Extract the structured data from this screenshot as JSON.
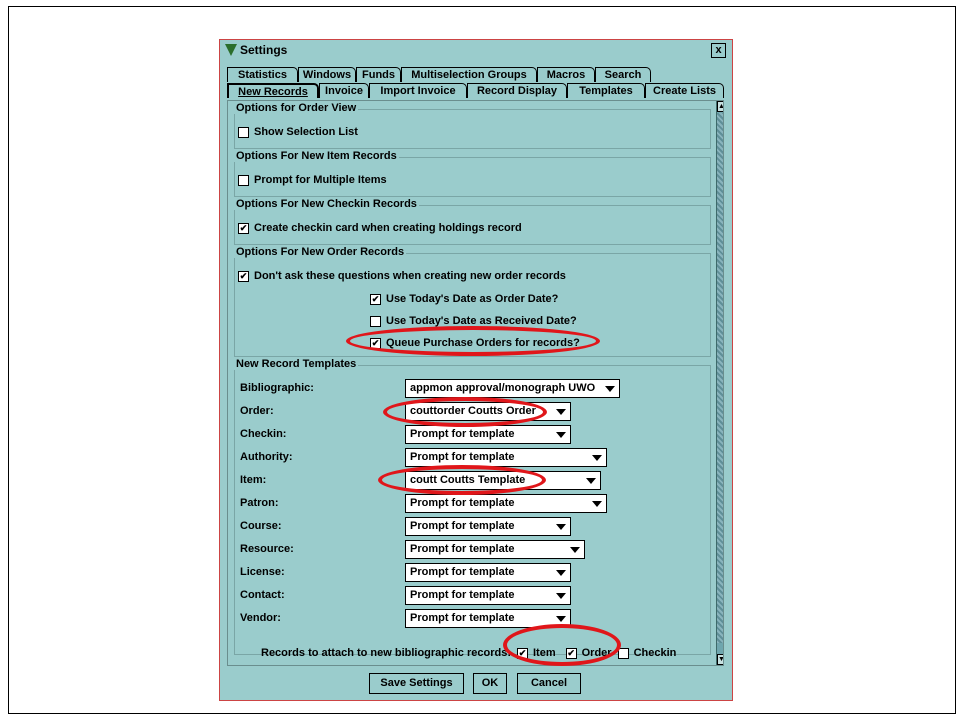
{
  "window": {
    "title": "Settings",
    "close_label": "x"
  },
  "tabs_row1": [
    "Statistics",
    "Windows",
    "Funds",
    "Multiselection Groups",
    "Macros",
    "Search"
  ],
  "tabs_row2": [
    "New Records",
    "Invoice",
    "Import Invoice",
    "Record Display",
    "Templates",
    "Create Lists"
  ],
  "active_tab": "New Records",
  "order_view": {
    "title": "Options for Order View",
    "show_selection_list": {
      "label": "Show Selection List",
      "checked": false
    }
  },
  "new_item": {
    "title": "Options For New Item Records",
    "prompt_multiple": {
      "label": "Prompt for Multiple Items",
      "checked": false
    }
  },
  "new_checkin": {
    "title": "Options For New Checkin Records",
    "create_card": {
      "label": "Create checkin card when creating holdings record",
      "checked": true
    }
  },
  "new_order": {
    "title": "Options For New Order Records",
    "dont_ask": {
      "label": "Don't ask these questions when creating new order records",
      "checked": true
    },
    "todays_date_order": {
      "label": "Use Today's Date as Order Date?",
      "checked": true
    },
    "todays_date_received": {
      "label": "Use Today's Date as Received Date?",
      "checked": false
    },
    "queue_po": {
      "label": "Queue Purchase Orders for records?",
      "checked": true
    }
  },
  "templates": {
    "title": "New Record Templates",
    "rows": [
      {
        "label": "Bibliographic:",
        "value": "appmon approval/monograph UWO"
      },
      {
        "label": "Order:",
        "value": "couttorder Coutts Order"
      },
      {
        "label": "Checkin:",
        "value": "Prompt for template"
      },
      {
        "label": "Authority:",
        "value": "Prompt for template"
      },
      {
        "label": "Item:",
        "value": "coutt Coutts Template"
      },
      {
        "label": "Patron:",
        "value": "Prompt for template"
      },
      {
        "label": "Course:",
        "value": "Prompt for template"
      },
      {
        "label": "Resource:",
        "value": "Prompt for template"
      },
      {
        "label": "License:",
        "value": "Prompt for template"
      },
      {
        "label": "Contact:",
        "value": "Prompt for template"
      },
      {
        "label": "Vendor:",
        "value": "Prompt for template"
      }
    ]
  },
  "attach": {
    "label": "Records to attach to new bibliographic records:",
    "item": {
      "label": "Item",
      "checked": true
    },
    "order": {
      "label": "Order",
      "checked": true
    },
    "checkin": {
      "label": "Checkin",
      "checked": false
    }
  },
  "buttons": {
    "save": "Save Settings",
    "ok": "OK",
    "cancel": "Cancel"
  },
  "colors": {
    "panel": "#9acccc",
    "highlight_ring": "#e0161a"
  },
  "check_mark": "✔"
}
